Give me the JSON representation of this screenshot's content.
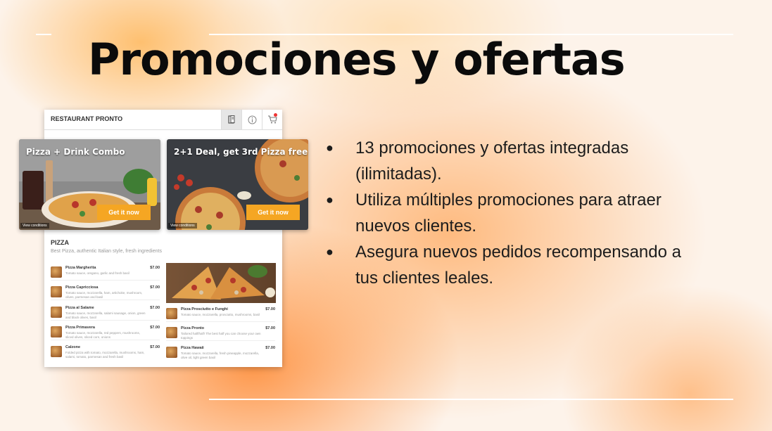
{
  "slide": {
    "title": "Promociones y ofertas",
    "bullets": [
      "13 promociones y ofertas integradas (ilimitadas).",
      "Utiliza múltiples promociones para atraer nuevos clientes.",
      "Asegura nuevos pedidos recompensando a tus clientes leales."
    ]
  },
  "app": {
    "brand": "RESTAURANT PRONTO",
    "header_icons": [
      "menu-book-icon",
      "info-icon",
      "cart-icon"
    ],
    "promos": [
      {
        "title": "Pizza + Drink Combo",
        "button": "Get it now",
        "conditions": "View conditions"
      },
      {
        "title": "2+1 Deal, get 3rd Pizza free",
        "button": "Get it now",
        "conditions": "View conditions"
      }
    ],
    "section": {
      "title": "PIZZA",
      "subtitle": "Best Pizza, authentic Italian style, fresh ingredients"
    },
    "menu_left": [
      {
        "name": "Pizza Margherita",
        "desc": "Tomato sauce, oregano, garlic and fresh basil",
        "price": "$7.00"
      },
      {
        "name": "Pizza Capricciosa",
        "desc": "Tomato sauce, mozzarella, ham, artichoke, mushroom, olives, parmesan and basil",
        "price": "$7.00"
      },
      {
        "name": "Pizza al Salame",
        "desc": "Tomato sauce, mozzarella, salami sausage, onion, green and black olives, basil",
        "price": "$7.00"
      },
      {
        "name": "Pizza Primavera",
        "desc": "Tomato sauce, mozzarella, red peppers, mushrooms, sliced olives, sliced corn, onions",
        "price": "$7.00"
      },
      {
        "name": "Calzone",
        "desc": "Folded pizza with tomato, mozzarella, mushrooms, ham, salami, tomato, parmesan and fresh basil",
        "price": "$7.00"
      }
    ],
    "menu_right": [
      {
        "name": "Pizza Prosciutto e Funghi",
        "desc": "Tomato sauce, mozzarella, prosciutto, mushrooms, basil",
        "price": "$7.00"
      },
      {
        "name": "Pizza Pronto",
        "desc": "Tailored half/half! The best half you can choose your own toppings",
        "price": "$7.00"
      },
      {
        "name": "Pizza Hawaii",
        "desc": "Tomato sauce, mozzarella, fresh pineapple, mozzarella, olive oil, light green basil",
        "price": "$7.00"
      }
    ]
  }
}
